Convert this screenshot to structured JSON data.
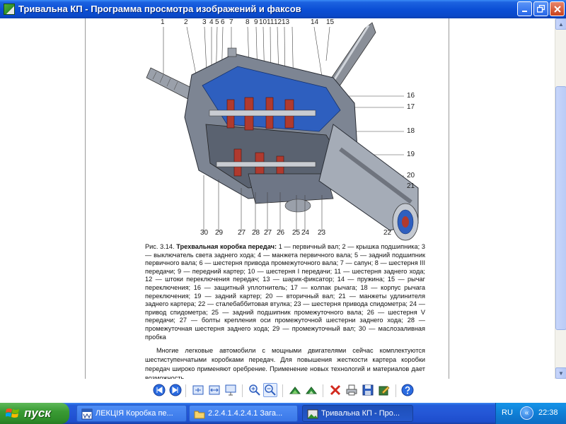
{
  "window": {
    "title": "Тривальна КП - Программа просмотра изображений и факсов",
    "icons": {
      "app": "image-viewer-icon",
      "min": "minimize-icon",
      "max": "restore-icon",
      "close": "close-icon"
    }
  },
  "figure": {
    "top_numbers": [
      "1",
      "2",
      "3",
      "4",
      "5",
      "6",
      "7",
      "8",
      "9",
      "10",
      "11",
      "12",
      "13",
      "14",
      "15"
    ],
    "right_numbers": [
      "16",
      "17",
      "18",
      "19",
      "20",
      "21"
    ],
    "bottom_numbers": [
      "30",
      "29",
      "27",
      "28",
      "27",
      "26",
      "25",
      "24",
      "23",
      "22"
    ]
  },
  "caption": {
    "label": "Рис. 3.14.",
    "title": "Трехвальная коробка передач:",
    "text": "1 — первичный вал; 2 — крышка подшипника; 3 — выключатель света заднего хода; 4 — манжета первичного вала; 5 — задний подшипник первичного вала; 6 — шестерня привода промежуточного вала; 7 — сапун; 8 — шестерня III передачи; 9 — передний картер; 10 — шестерня I передачи; 11 — шестерня заднего хода; 12 — штоки переключения передач; 13 — шарик-фиксатор; 14 — пружина; 15 — рычаг переключения; 16 — защитный уплотнитель; 17 — колпак рычага; 18 — корпус рычага переключения; 19 — задний картер; 20 — вторичный вал; 21 — манжеты удлинителя заднего картера; 22 — сталебаббитовая втулка; 23 — шестерня привода спидометра; 24 — привод спидометра; 25 — задний подшипник промежуточного вала; 26 — шестерня V передачи; 27 — болты крепления оси промежуточной шестерни заднего хода; 28 — промежуточная шестерня заднего хода; 29 — промежуточный вал; 30 — маслозаливная пробка"
  },
  "body_text": "Многие легковые автомобили с мощными двигателями сейчас комплектуются шестиступенчатыми коробками передач. Для повышения жесткости картера коробки передач широко применяют оребрение. Применение новых технологий и материалов дает возможность",
  "scrollbar": {
    "up": "▲",
    "down": "▼"
  },
  "toolbar": {
    "buttons": [
      "previous-image-icon",
      "next-image-icon",
      "best-fit-icon",
      "actual-size-icon",
      "slideshow-icon",
      "zoom-in-icon",
      "zoom-out-icon",
      "rotate-clockwise-icon",
      "rotate-counterclockwise-icon",
      "delete-icon",
      "print-icon",
      "save-icon",
      "edit-icon",
      "help-icon"
    ]
  },
  "taskbar": {
    "start_label": "пуск",
    "tasks": [
      {
        "label": "ЛЕКЦІЯ Коробка пе...",
        "icon": "word-document-icon",
        "active": false
      },
      {
        "label": "2.2.4.1.4.2.4.1 Зага...",
        "icon": "folder-icon",
        "active": false
      },
      {
        "label": "Тривальна КП - Про...",
        "icon": "image-viewer-icon",
        "active": true
      }
    ],
    "language": "RU",
    "tray_arrow": "«",
    "clock": "22:38"
  }
}
